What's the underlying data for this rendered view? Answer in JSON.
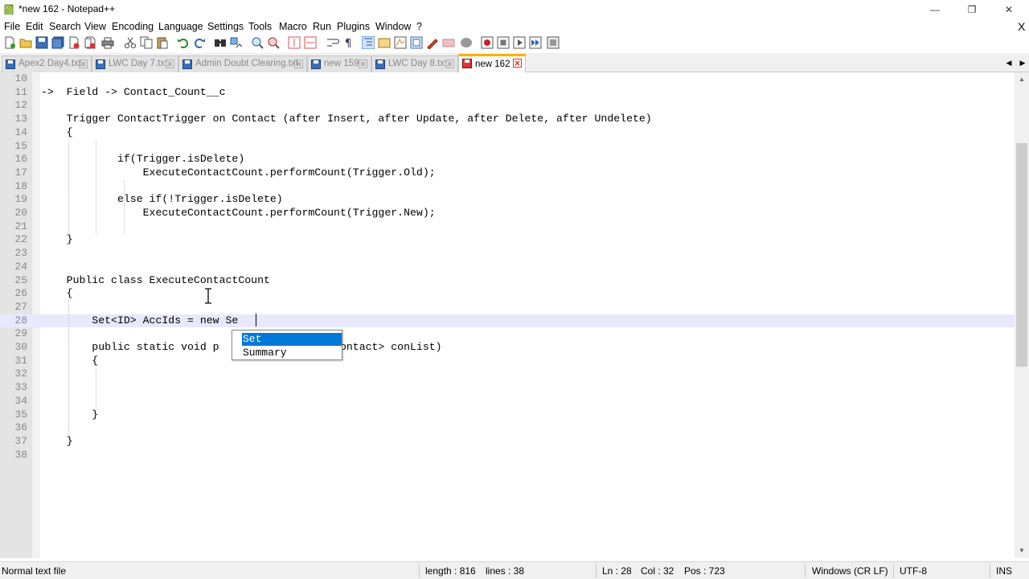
{
  "window": {
    "title": "*new 162 - Notepad++",
    "min_glyph": "—",
    "restore_glyph": "❐",
    "close_glyph": "✕"
  },
  "menu": {
    "items": [
      "File",
      "Edit",
      "Search",
      "View",
      "Encoding",
      "Language",
      "Settings",
      "Tools",
      "Macro",
      "Run",
      "Plugins",
      "Window",
      "?"
    ],
    "doc_close": "X"
  },
  "toolbar": {
    "icons": [
      "new-file-icon",
      "open-file-icon",
      "save-icon",
      "save-all-icon",
      "close-icon",
      "close-all-icon",
      "print-icon",
      "cut-icon",
      "copy-icon",
      "paste-icon",
      "undo-icon",
      "redo-icon",
      "find-icon",
      "replace-icon",
      "zoom-in-icon",
      "zoom-out-icon",
      "sync-vertical-icon",
      "sync-horizontal-icon",
      "word-wrap-icon",
      "show-all-chars-icon",
      "indent-guide-icon",
      "udl-icon",
      "doc-map-icon",
      "function-list-icon",
      "folder-workspace-icon",
      "monitoring-icon",
      "record-macro-icon",
      "stop-macro-icon",
      "play-macro-icon",
      "run-macro-multiple-icon",
      "save-macro-icon"
    ]
  },
  "tabs": [
    {
      "label": "Apex2 Day4.txt",
      "active": false
    },
    {
      "label": "LWC Day 7.txt",
      "active": false
    },
    {
      "label": "Admin Doubt Clearing.txt",
      "active": false
    },
    {
      "label": "new 159",
      "active": false
    },
    {
      "label": "LWC Day 8.txt",
      "active": false
    },
    {
      "label": "new 162",
      "active": true
    }
  ],
  "editor": {
    "lines": [
      {
        "n": "10",
        "text": ""
      },
      {
        "n": "11",
        "text": "->  Field -> Contact_Count__c"
      },
      {
        "n": "12",
        "text": ""
      },
      {
        "n": "13",
        "text": "    Trigger ContactTrigger on Contact (after Insert, after Update, after Delete, after Undelete)"
      },
      {
        "n": "14",
        "text": "    {"
      },
      {
        "n": "15",
        "text": ""
      },
      {
        "n": "16",
        "text": "            if(Trigger.isDelete)"
      },
      {
        "n": "17",
        "text": "                ExecuteContactCount.performCount(Trigger.Old);"
      },
      {
        "n": "18",
        "text": ""
      },
      {
        "n": "19",
        "text": "            else if(!Trigger.isDelete)"
      },
      {
        "n": "20",
        "text": "                ExecuteContactCount.performCount(Trigger.New);"
      },
      {
        "n": "21",
        "text": ""
      },
      {
        "n": "22",
        "text": "    }"
      },
      {
        "n": "23",
        "text": ""
      },
      {
        "n": "24",
        "text": ""
      },
      {
        "n": "25",
        "text": "    Public class ExecuteContactCount"
      },
      {
        "n": "26",
        "text": "    {"
      },
      {
        "n": "27",
        "text": ""
      },
      {
        "n": "28",
        "text": "        Set<ID> AccIds = new Se"
      },
      {
        "n": "29",
        "text": ""
      },
      {
        "n": "30",
        "text": "        public static void p                t<Contact> conList)"
      },
      {
        "n": "31",
        "text": "        {"
      },
      {
        "n": "32",
        "text": ""
      },
      {
        "n": "33",
        "text": ""
      },
      {
        "n": "34",
        "text": ""
      },
      {
        "n": "35",
        "text": "        }"
      },
      {
        "n": "36",
        "text": ""
      },
      {
        "n": "37",
        "text": "    }"
      },
      {
        "n": "38",
        "text": ""
      }
    ],
    "current_line": "28"
  },
  "autocomplete": {
    "items": [
      "Set",
      "Summary"
    ],
    "selected": "Set"
  },
  "statusbar": {
    "file_type": "Normal text file",
    "length": "length : 816",
    "lines": "lines : 38",
    "ln": "Ln : 28",
    "col": "Col : 32",
    "pos": "Pos : 723",
    "eol": "Windows (CR LF)",
    "encoding": "UTF-8",
    "mode": "INS"
  },
  "colors": {
    "active_tab_accent": "#fab000",
    "current_line_bg": "#e8e8ff",
    "autocomplete_selected": "#0078d7",
    "gutter_bg": "#e4e4e4"
  }
}
